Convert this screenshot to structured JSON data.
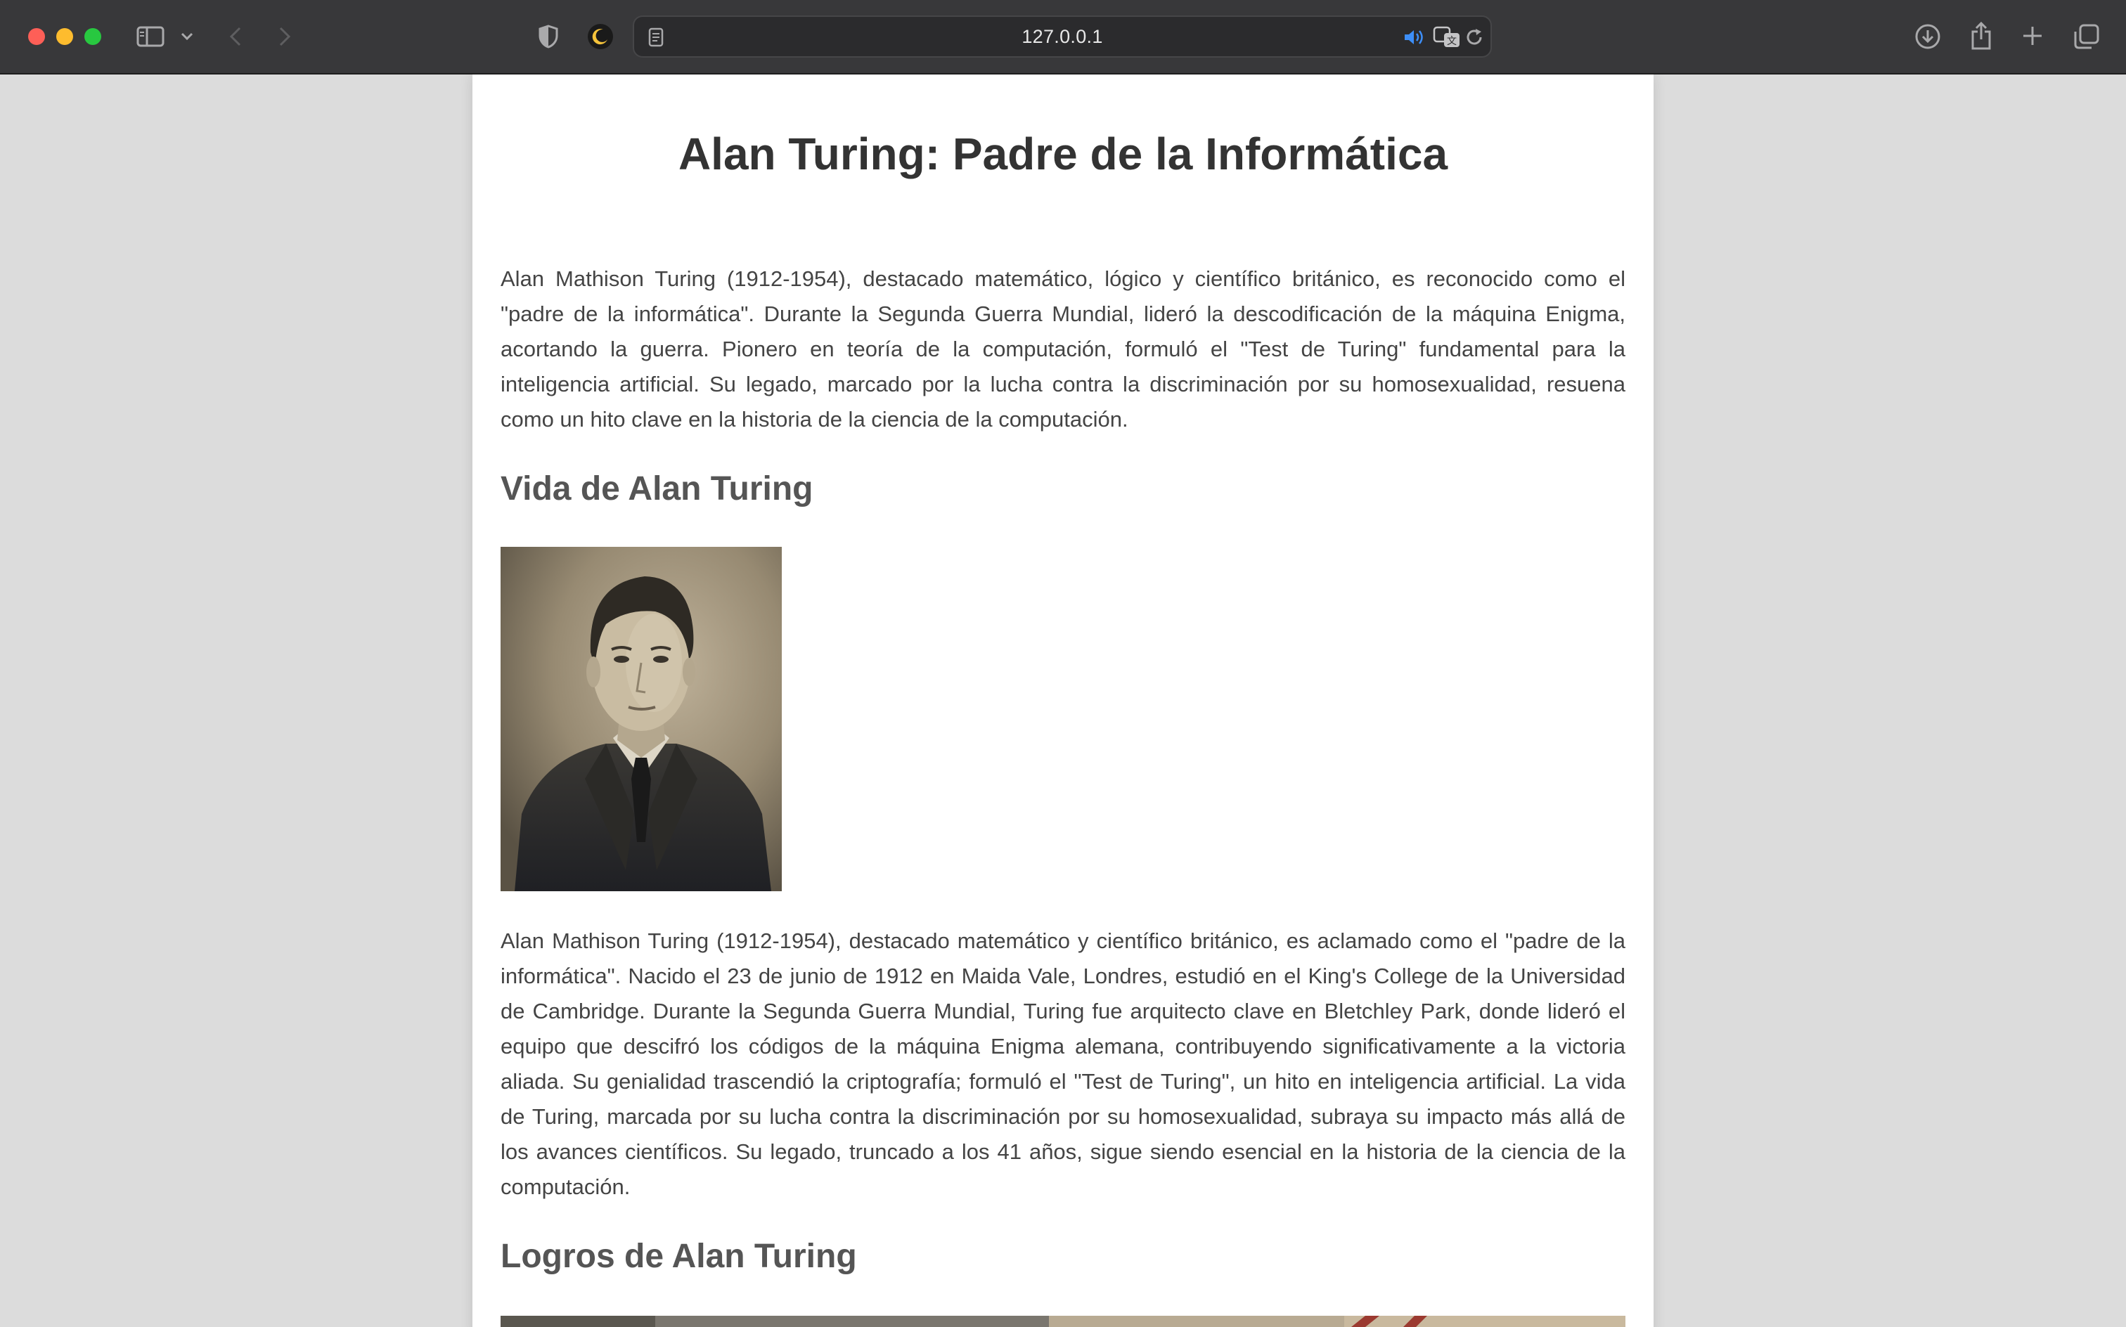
{
  "browser": {
    "url": "127.0.0.1"
  },
  "page": {
    "title": "Alan Turing: Padre de la Informática",
    "intro": "Alan Mathison Turing (1912-1954), destacado matemático, lógico y científico británico, es reconocido como el \"padre de la informática\". Durante la Segunda Guerra Mundial, lideró la descodificación de la máquina Enigma, acortando la guerra. Pionero en teoría de la computación, formuló el \"Test de Turing\" fundamental para la inteligencia artificial. Su legado, marcado por la lucha contra la discriminación por su homosexualidad, resuena como un hito clave en la historia de la ciencia de la computación.",
    "life": {
      "heading": "Vida de Alan Turing",
      "body": "Alan Mathison Turing (1912-1954), destacado matemático y científico británico, es aclamado como el \"padre de la informática\". Nacido el 23 de junio de 1912 en Maida Vale, Londres, estudió en el King's College de la Universidad de Cambridge. Durante la Segunda Guerra Mundial, Turing fue arquitecto clave en Bletchley Park, donde lideró el equipo que descifró los códigos de la máquina Enigma alemana, contribuyendo significativamente a la victoria aliada. Su genialidad trascendió la criptografía; formuló el \"Test de Turing\", un hito en inteligencia artificial. La vida de Turing, marcada por su lucha contra la discriminación por su homosexualidad, subraya su impacto más allá de los avances científicos. Su legado, truncado a los 41 años, sigue siendo esencial en la historia de la ciencia de la computación."
    },
    "achievements": {
      "heading": "Logros de Alan Turing"
    }
  }
}
